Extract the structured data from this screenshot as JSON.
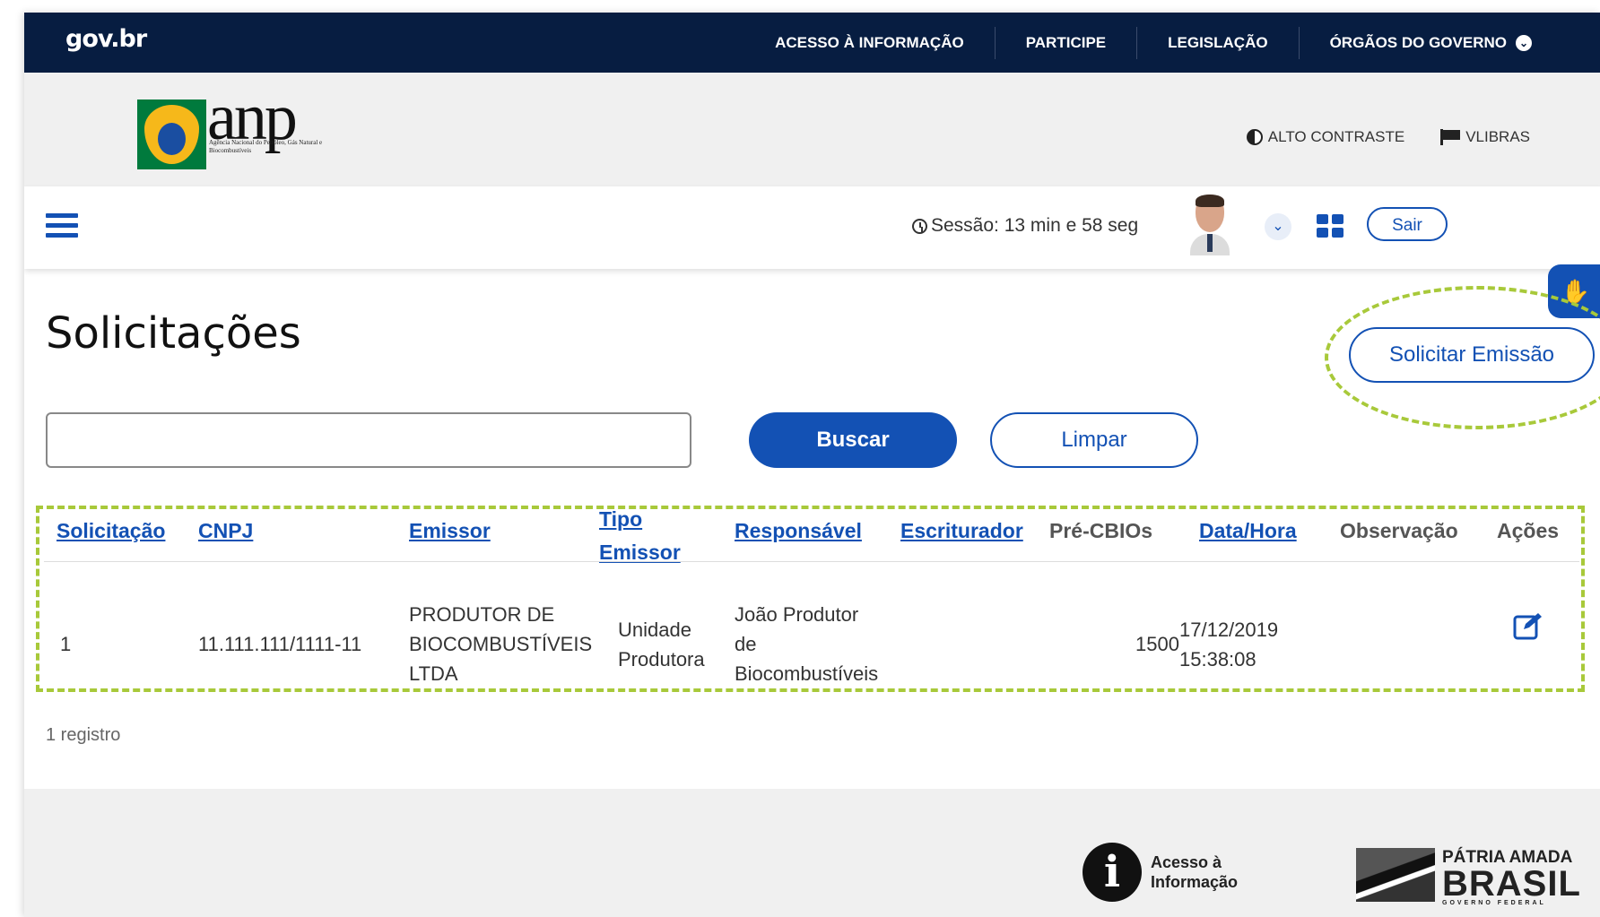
{
  "gov": {
    "logo": "gov.br",
    "nav": [
      "ACESSO À INFORMAÇÃO",
      "PARTICIPE",
      "LEGISLAÇÃO",
      "ÓRGÃOS DO GOVERNO"
    ],
    "chevron": "⌄"
  },
  "header": {
    "anp_word": "anp",
    "anp_subtitle": "Agência Nacional do Petróleo, Gás Natural e Biocombustíveis",
    "alto_contraste": "ALTO CONTRASTE",
    "vlibras": "VLIBRAS"
  },
  "toolbar": {
    "session": "Sessão: 13 min e 58 seg",
    "sair": "Sair"
  },
  "page": {
    "title": "Solicitações",
    "solicitar_label": "Solicitar Emissão",
    "search_value": "",
    "buscar_label": "Buscar",
    "limpar_label": "Limpar"
  },
  "table": {
    "headers": [
      "Solicitação",
      "CNPJ",
      "Emissor",
      "Tipo Emissor",
      "Responsável",
      "Escriturador",
      "Pré-CBIOs",
      "Data/Hora",
      "Observação",
      "Ações"
    ],
    "row": {
      "solicitacao": "1",
      "cnpj": "11.111.111/1111-11",
      "emissor": [
        "PRODUTOR DE",
        "BIOCOMBUSTÍVEIS",
        "LTDA"
      ],
      "tipo": [
        "Unidade",
        "Produtora"
      ],
      "responsavel": [
        "João Produtor",
        "de",
        "Biocombustíveis"
      ],
      "escriturador": "",
      "pre_cbios": "1500",
      "data": [
        "17/12/2019",
        "15:38:08"
      ],
      "observacao": ""
    },
    "footer": "1 registro"
  },
  "footer": {
    "acesso": [
      "Acesso à",
      "Informação"
    ],
    "patria": "PÁTRIA AMADA",
    "brasil": "BRASIL",
    "governo": "GOVERNO FEDERAL"
  },
  "colors": {
    "primary": "#1351b4",
    "govbar": "#071d41",
    "highlight": "#a8c93a"
  }
}
